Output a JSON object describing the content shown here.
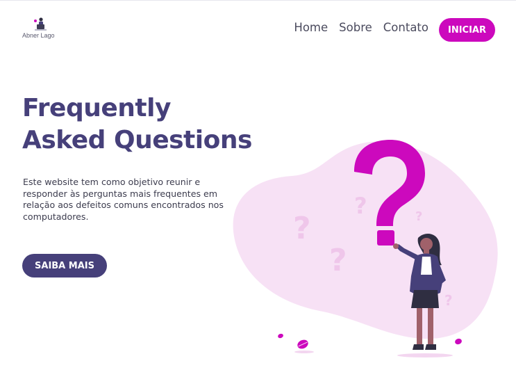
{
  "header": {
    "logo_text": "Abner Lago",
    "nav": [
      {
        "label": "Home"
      },
      {
        "label": "Sobre"
      },
      {
        "label": "Contato"
      }
    ],
    "cta_label": "INICIAR"
  },
  "hero": {
    "title_line1": "Frequently",
    "title_line2": "Asked Questions",
    "description": "Este website tem como objetivo reunir e responder às perguntas mais frequentes em relação aos defeitos comuns encontrados nos computadores.",
    "button_label": "SAIBA MAIS"
  },
  "colors": {
    "primary": "#46407a",
    "accent": "#cc09bd",
    "blob": "#f7e1f5"
  },
  "icons": {
    "logo": "person-at-laptop-icon",
    "illustration": "woman-holding-question-mark-illustration"
  }
}
